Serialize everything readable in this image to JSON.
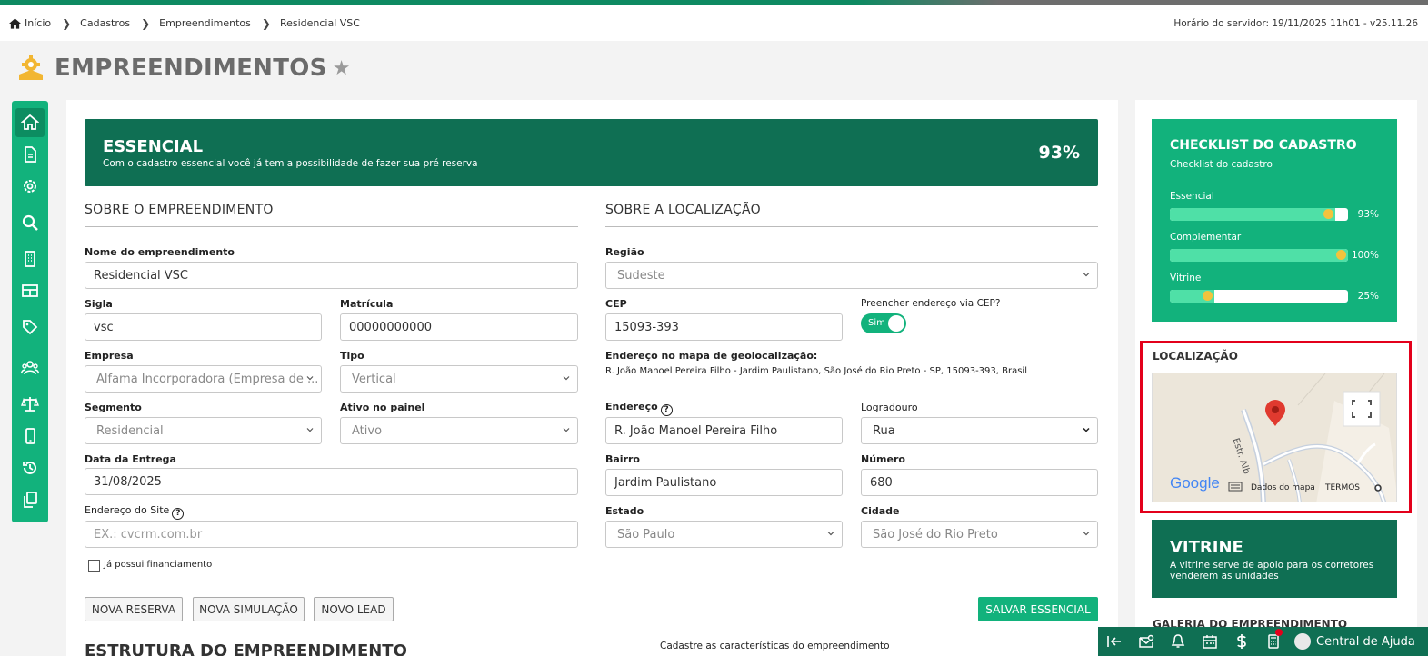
{
  "breadcrumb": {
    "items": [
      "Início",
      "Cadastros",
      "Empreendimentos",
      "Residencial VSC"
    ]
  },
  "server_time": "Horário do servidor: 19/11/2025 11h01 - v25.11.26",
  "page": {
    "title": "EMPREENDIMENTOS"
  },
  "hero": {
    "title": "ESSENCIAL",
    "subtitle": "Com o cadastro essencial você já tem a possibilidade de fazer sua pré reserva",
    "percent": "93%"
  },
  "sobre_empreendimento": {
    "title": "SOBRE O EMPREENDIMENTO",
    "nome_label": "Nome do empreendimento",
    "nome_value": "Residencial VSC",
    "sigla_label": "Sigla",
    "sigla_value": "vsc",
    "matricula_label": "Matrícula",
    "matricula_value": "00000000000",
    "empresa_label": "Empresa",
    "empresa_value": "Alfama Incorporadora (Empresa de ...",
    "tipo_label": "Tipo",
    "tipo_value": "Vertical",
    "segmento_label": "Segmento",
    "segmento_value": "Residencial",
    "ativo_label": "Ativo no painel",
    "ativo_value": "Ativo",
    "data_label": "Data da Entrega",
    "data_value": "31/08/2025",
    "site_label": "Endereço do Site",
    "site_placeholder": "EX.: cvcrm.com.br",
    "financiamento_label": "Já possui financiamento"
  },
  "sobre_localizacao": {
    "title": "SOBRE A LOCALIZAÇÃO",
    "regiao_label": "Região",
    "regiao_value": "Sudeste",
    "cep_label": "CEP",
    "cep_value": "15093-393",
    "via_cep_label": "Preencher endereço via CEP?",
    "toggle_label": "Sim",
    "geo_label": "Endereço no mapa de geolocalização:",
    "geo_value": "R. João Manoel Pereira Filho - Jardim Paulistano, São José do Rio Preto - SP, 15093-393, Brasil",
    "endereco_label": "Endereço",
    "endereco_value": "R. João Manoel Pereira Filho",
    "logradouro_label": "Logradouro",
    "logradouro_value": "Rua",
    "bairro_label": "Bairro",
    "bairro_value": "Jardim Paulistano",
    "numero_label": "Número",
    "numero_value": "680",
    "estado_label": "Estado",
    "estado_value": "São Paulo",
    "cidade_label": "Cidade",
    "cidade_value": "São José do Rio Preto"
  },
  "actions": {
    "nova_reserva": "NOVA RESERVA",
    "nova_simulacao": "NOVA SIMULAÇÃO",
    "novo_lead": "NOVO LEAD",
    "salvar": "SALVAR ESSENCIAL"
  },
  "estrutura": {
    "title": "ESTRUTURA DO EMPREENDIMENTO",
    "subtitle": "Cadastre as características do empreendimento"
  },
  "checklist": {
    "title": "CHECKLIST DO CADASTRO",
    "subtitle": "Checklist do cadastro",
    "items": [
      {
        "label": "Essencial",
        "percent": "93%",
        "value": 0.93
      },
      {
        "label": "Complementar",
        "percent": "100%",
        "value": 1.0
      },
      {
        "label": "Vitrine",
        "percent": "25%",
        "value": 0.25
      }
    ]
  },
  "localizacao": {
    "title": "LOCALIZAÇÃO",
    "map_data": "Dados do mapa",
    "map_terms": "TERMOS",
    "google": "Google",
    "street": "Estr. Alb"
  },
  "vitrine": {
    "title": "VITRINE",
    "subtitle": "A vitrine serve de apoio para os corretores venderem as unidades"
  },
  "galeria": {
    "title": "GALERIA DO EMPREENDIMENTO"
  },
  "bottom_bar": {
    "help_center": "Central de Ajuda"
  },
  "colors": {
    "primary": "#12b27c",
    "dark_green": "#0f6f53",
    "highlight": "#e3001b"
  }
}
